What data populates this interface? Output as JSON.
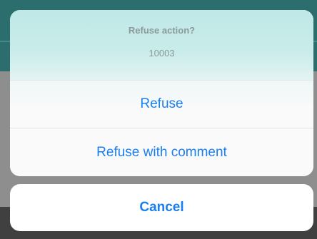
{
  "action_sheet": {
    "title": "Refuse action?",
    "message": "10003",
    "actions": [
      {
        "label": "Refuse"
      },
      {
        "label": "Refuse with comment"
      }
    ],
    "cancel_label": "Cancel"
  },
  "colors": {
    "accent": "#1a7ff0",
    "header_tint": "#c9ecea",
    "background_header": "#2c6e6e"
  }
}
